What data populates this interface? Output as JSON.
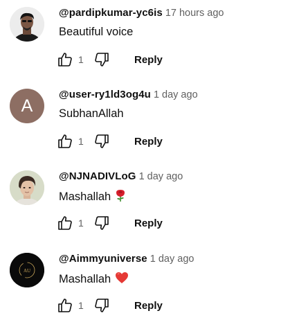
{
  "comments": [
    {
      "author": "@pardipkumar-yc6is",
      "time": "17 hours ago",
      "text": "Beautiful voice",
      "emoji": "",
      "likes": "1",
      "reply_label": "Reply",
      "avatar": {
        "type": "photo",
        "icon": "person-photo-avatar",
        "bg": "#e9e9e9"
      }
    },
    {
      "author": "@user-ry1ld3og4u",
      "time": "1 day ago",
      "text": "SubhanAllah",
      "emoji": "",
      "likes": "1",
      "reply_label": "Reply",
      "avatar": {
        "type": "letter",
        "letter": "A",
        "bg": "#8d6e63"
      }
    },
    {
      "author": "@NJNADIVLoG",
      "time": "1 day ago",
      "text": "Mashallah",
      "emoji": "rose-emoji",
      "likes": "1",
      "reply_label": "Reply",
      "avatar": {
        "type": "photo",
        "icon": "person-photo-avatar",
        "bg": "#cfd8c0"
      }
    },
    {
      "author": "@Aimmyuniverse",
      "time": "1 day ago",
      "text": "Mashallah",
      "emoji": "red-heart-emoji",
      "likes": "1",
      "reply_label": "Reply",
      "avatar": {
        "type": "logo",
        "logo_text": "AU",
        "bg": "#0a0a0a"
      }
    }
  ],
  "colors": {
    "text": "#0f0f0f",
    "secondary": "#606060",
    "background": "#ffffff"
  },
  "icons": {
    "like": "thumb-up-icon",
    "dislike": "thumb-down-icon"
  }
}
